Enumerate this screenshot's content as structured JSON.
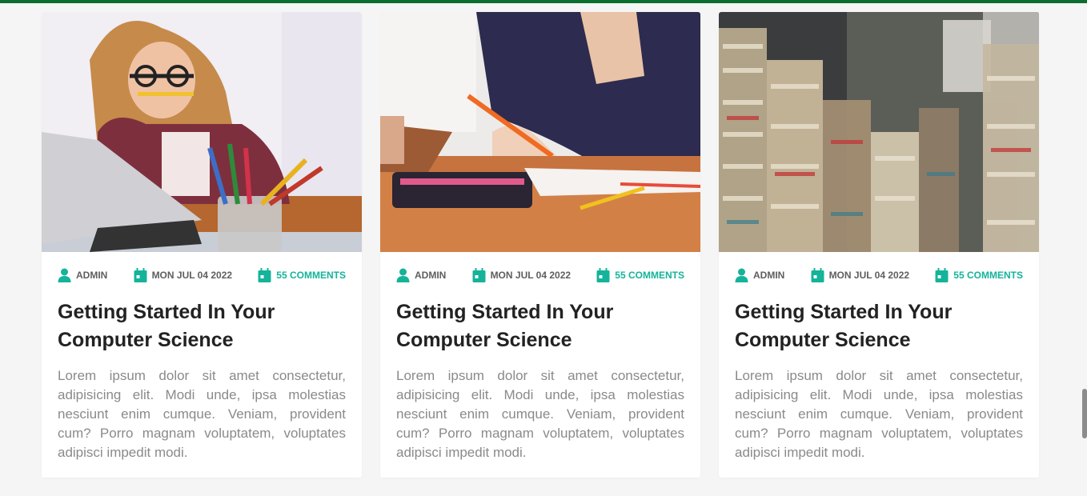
{
  "theme": {
    "accent": "#15b39a",
    "top_bar": "#0b6e2f"
  },
  "posts": [
    {
      "image": "woman-with-pencil-and-laptop",
      "author": "ADMIN",
      "date": "MON JUL 04 2022",
      "comments": "55 COMMENTS",
      "title": "Getting Started In Your Computer Science",
      "excerpt": "Lorem ipsum dolor sit amet consectetur, adipisicing elit. Modi unde, ipsa molestias nesciunt enim cumque. Veniam, provident cum? Porro magnam voluptatem, voluptates adipisci impedit modi."
    },
    {
      "image": "student-drawing-at-desk",
      "author": "ADMIN",
      "date": "MON JUL 04 2022",
      "comments": "55 COMMENTS",
      "title": "Getting Started In Your Computer Science",
      "excerpt": "Lorem ipsum dolor sit amet consectetur, adipisicing elit. Modi unde, ipsa molestias nesciunt enim cumque. Veniam, provident cum? Porro magnam voluptatem, voluptates adipisci impedit modi."
    },
    {
      "image": "stacks-of-books",
      "author": "ADMIN",
      "date": "MON JUL 04 2022",
      "comments": "55 COMMENTS",
      "title": "Getting Started In Your Computer Science",
      "excerpt": "Lorem ipsum dolor sit amet consectetur, adipisicing elit. Modi unde, ipsa molestias nesciunt enim cumque. Veniam, provident cum? Porro magnam voluptatem, voluptates adipisci impedit modi."
    }
  ]
}
